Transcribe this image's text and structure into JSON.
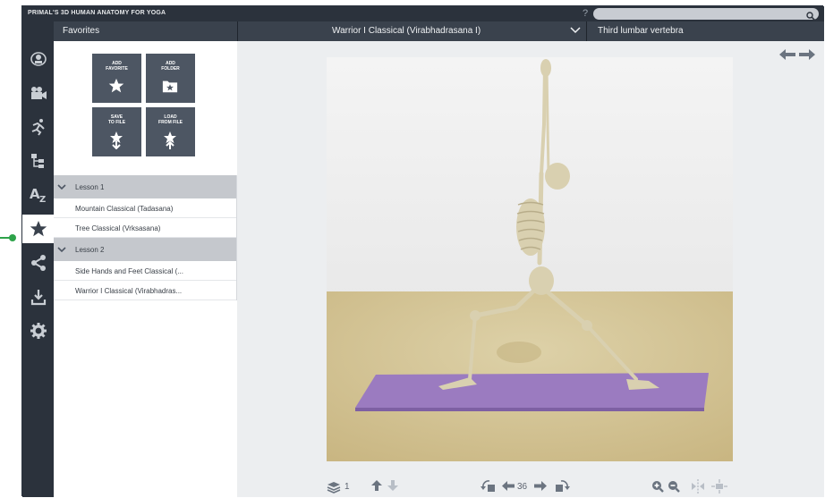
{
  "app": {
    "title": "PRIMAL'S 3D HUMAN ANATOMY FOR YOGA",
    "help": "?"
  },
  "topbar": {
    "favorites_title": "Favorites",
    "pose_title": "Warrior I Classical (Virabhadrasana I)",
    "structure_title": "Third lumbar vertebra"
  },
  "sidebar": {
    "items": [
      {
        "name": "rotate-model-icon"
      },
      {
        "name": "video-camera-icon"
      },
      {
        "name": "running-pose-icon"
      },
      {
        "name": "hierarchy-icon"
      },
      {
        "name": "a-to-z-icon"
      },
      {
        "name": "star-icon",
        "active": true
      },
      {
        "name": "share-icon"
      },
      {
        "name": "download-icon"
      },
      {
        "name": "gear-icon"
      }
    ]
  },
  "favorites": {
    "tiles": [
      {
        "label1": "ADD",
        "label2": "FAVORITE",
        "icon": "star-icon"
      },
      {
        "label1": "ADD",
        "label2": "FOLDER",
        "icon": "add-folder-icon"
      },
      {
        "label1": "SAVE",
        "label2": "TO FILE",
        "icon": "save-file-icon"
      },
      {
        "label1": "LOAD",
        "label2": "FROM FILE",
        "icon": "load-file-icon"
      }
    ],
    "lessons": [
      {
        "title": "Lesson 1",
        "items": [
          "Mountain Classical (Tadasana)",
          "Tree Classical (Vrksasana)"
        ]
      },
      {
        "title": "Lesson 2",
        "items": [
          "Side Hands and Feet Classical (...",
          "Warrior I Classical (Virabhadras..."
        ]
      }
    ]
  },
  "viewer": {
    "layer_count": "1",
    "angle": "36"
  },
  "colors": {
    "dark": "#2b323c",
    "topbar": "#3a424d",
    "tile": "#4d5663",
    "lesson_header": "#c5c8cd",
    "mat": "#9b7bc0",
    "floor": "#d7c89b",
    "callout": "#2ea34a"
  }
}
